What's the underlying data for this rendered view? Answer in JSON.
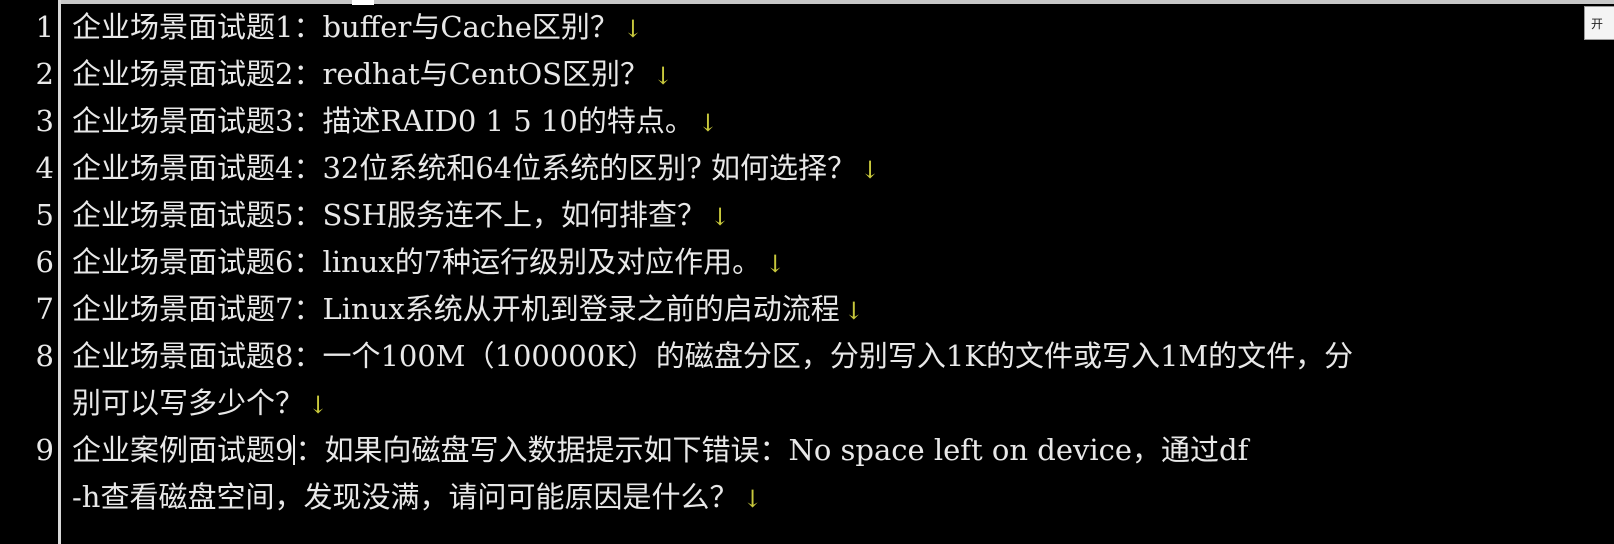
{
  "corner_button": {
    "label": "开"
  },
  "lines": [
    {
      "number": "1",
      "text": "企业场景面试题1：buffer与Cache区别？",
      "arrow": "↓"
    },
    {
      "number": "2",
      "text": "企业场景面试题2：redhat与CentOS区别？",
      "arrow": "↓"
    },
    {
      "number": "3",
      "text": "企业场景面试题3：描述RAID0 1 5 10的特点。",
      "arrow": "↓"
    },
    {
      "number": "4",
      "text": "企业场景面试题4：32位系统和64位系统的区别? 如何选择？",
      "arrow": "↓"
    },
    {
      "number": "5",
      "text": "企业场景面试题5：SSH服务连不上，如何排查？",
      "arrow": "↓"
    },
    {
      "number": "6",
      "text": "企业场景面试题6：linux的7种运行级别及对应作用。",
      "arrow": "↓"
    },
    {
      "number": "7",
      "text": "企业场景面试题7：Linux系统从开机到登录之前的启动流程",
      "arrow": "↓"
    },
    {
      "number": "8",
      "text": "企业场景面试题8：一个100M（100000K）的磁盘分区，分别写入1K的文件或写入1M的文件，分",
      "arrow": ""
    },
    {
      "number": "",
      "text": "别可以写多少个？",
      "arrow": "↓"
    },
    {
      "number": "9",
      "text_before_caret": "企业案例面试题9",
      "text": "：如果向磁盘写入数据提示如下错误：No space left on device，通过df",
      "arrow": ""
    },
    {
      "number": "",
      "text": "-h查看磁盘空间，发现没满，请问可能原因是什么？",
      "arrow": "↓"
    }
  ]
}
